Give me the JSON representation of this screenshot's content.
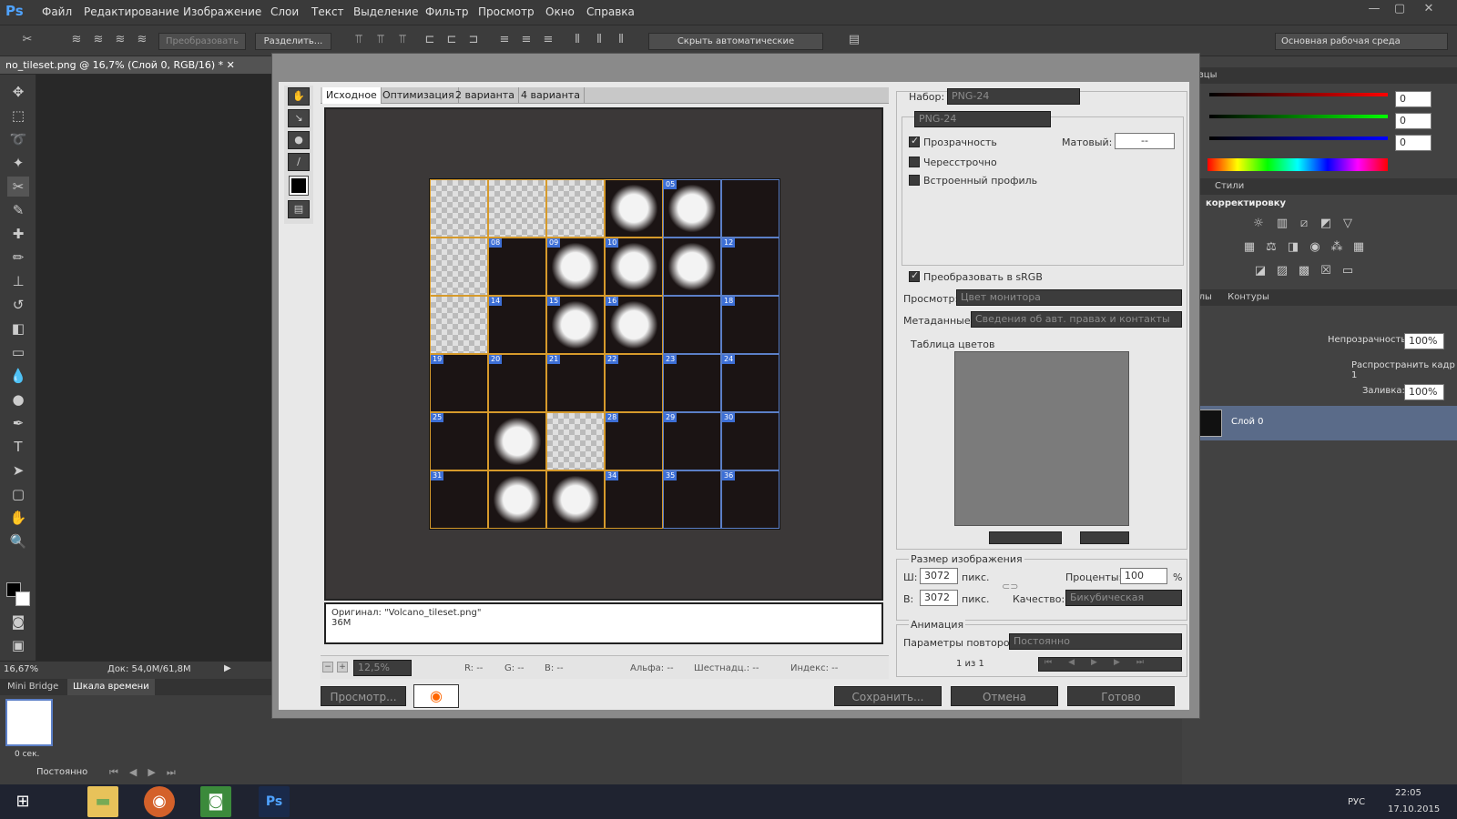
{
  "menubar": {
    "logo": "Ps",
    "items": [
      "Файл",
      "Редактирование",
      "Изображение",
      "Слои",
      "Текст",
      "Выделение",
      "Фильтр",
      "Просмотр",
      "Окно",
      "Справка"
    ],
    "win_buttons": [
      "—",
      "▢",
      "✕"
    ]
  },
  "options": {
    "btn_transform": "Преобразовать",
    "btn_split": "Разделить...",
    "btn_hide_auto": "Скрыть автоматические фрагменты",
    "workspace": "Основная рабочая среда"
  },
  "document": {
    "tab_title": "no_tileset.png @ 16,7% (Слой 0, RGB/16) *",
    "zoom": "16,67%",
    "doc_size": "Док: 54,0M/61,8M"
  },
  "bottom": {
    "tabs": [
      "Mini Bridge",
      "Шкала времени"
    ],
    "frame_time": "0 сек.",
    "loop": "Постоянно"
  },
  "dialog": {
    "tabs": [
      "Исходное",
      "Оптимизация",
      "2 варианта",
      "4 варианта"
    ],
    "info_line1": "Оригинал: \"Volcano_tileset.png\"",
    "info_line2": "36M",
    "zoom": "12,5%",
    "status": {
      "r": "R: --",
      "g": "G: --",
      "b": "B: --",
      "alpha": "Альфа: --",
      "hex": "Шестнадц.: --",
      "index": "Индекс: --"
    },
    "preview_btn": "Просмотр...",
    "save_btn": "Сохранить...",
    "cancel_btn": "Отмена",
    "done_btn": "Готово",
    "settings": {
      "preset_label": "Набор:",
      "preset_value": "PNG-24",
      "format_value": "PNG-24",
      "transparency": "Прозрачность",
      "matte_label": "Матовый:",
      "matte_value": "--",
      "interlaced": "Чересстрочно",
      "embedded_profile": "Встроенный профиль",
      "convert_srgb": "Преобразовать в sRGB",
      "preview_label": "Просмотр:",
      "preview_value": "Цвет монитора",
      "metadata_label": "Метаданные:",
      "metadata_value": "Сведения об авт. правах и контакты",
      "color_table": "Таблица цветов",
      "image_size": "Размер изображения",
      "w_label": "Ш:",
      "w_value": "3072",
      "h_label": "В:",
      "h_value": "3072",
      "unit": "пикс.",
      "percent_label": "Проценты:",
      "percent_value": "100",
      "percent_sign": "%",
      "quality_label": "Качество:",
      "quality_value": "Бикубическая",
      "animation": "Анимация",
      "loop_label": "Параметры повторов:",
      "loop_value": "Постоянно",
      "frame_counter": "1 из 1"
    },
    "tile_numbers": [
      "05",
      "08",
      "09",
      "10",
      "12",
      "14",
      "15",
      "16",
      "18",
      "19",
      "20",
      "21",
      "22",
      "23",
      "24",
      "25",
      "28",
      "29",
      "30",
      "31",
      "34",
      "35",
      "36"
    ]
  },
  "right_panel": {
    "swatches_title": "разцы",
    "rgb_values": [
      "0",
      "0",
      "0"
    ],
    "styles_tab": "Стили",
    "adjust_label": "корректировку",
    "channels_tab": "налы",
    "paths_tab": "Контуры",
    "opacity_label": "Непрозрачность:",
    "opacity_value": "100%",
    "spread_label": "Распространить кадр 1",
    "fill_label": "Заливка:",
    "fill_value": "100%",
    "layer_name": "Слой 0"
  },
  "taskbar": {
    "lang": "РУС",
    "time": "22:05",
    "date": "17.10.2015"
  }
}
